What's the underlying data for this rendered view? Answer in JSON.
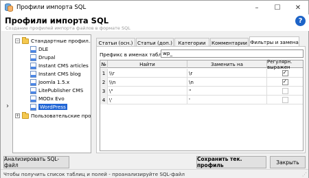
{
  "window": {
    "title": "Профили импорта SQL",
    "minimize": "–",
    "maximize": "☐",
    "close": "✕"
  },
  "header": {
    "title": "Профили импорта SQL",
    "subtitle": "Создание профилей импорта файлов в формате SQL",
    "help": "?"
  },
  "tree": {
    "items": [
      {
        "label": "Стандартные профил...",
        "type": "folder",
        "expander": "−"
      },
      {
        "label": "DLE",
        "type": "sql"
      },
      {
        "label": "Drupal",
        "type": "sql"
      },
      {
        "label": "Instant CMS articles",
        "type": "sql"
      },
      {
        "label": "Instant CMS blog",
        "type": "sql"
      },
      {
        "label": "Joomla 1.5.x",
        "type": "sql"
      },
      {
        "label": "LitePublisher CMS",
        "type": "sql"
      },
      {
        "label": "MODx Evo",
        "type": "sql"
      },
      {
        "label": "WordPress",
        "type": "sql",
        "selected": true
      },
      {
        "label": "Пользовательские про...",
        "type": "folder",
        "expander": "+"
      }
    ]
  },
  "tabs": [
    {
      "label": "Статьи (осн.)"
    },
    {
      "label": "Статьи (доп.)"
    },
    {
      "label": "Категории"
    },
    {
      "label": "Комментарии"
    },
    {
      "label": "Фильтры и замена",
      "active": true
    }
  ],
  "filters": {
    "prefix_label": "Префикс в именах таблиц:",
    "prefix_value": "wp_",
    "columns": [
      "№",
      "Найти",
      "Заменить на",
      "Регулярн. выражен"
    ],
    "rows": [
      {
        "num": "1",
        "find": "\\\\r",
        "replace": "\\r",
        "regex": true
      },
      {
        "num": "2",
        "find": "\\\\n",
        "replace": "\\n",
        "regex": true
      },
      {
        "num": "3",
        "find": "\\\"",
        "replace": "\"",
        "regex": false
      },
      {
        "num": "4",
        "find": "\\'",
        "replace": "'",
        "regex": false
      }
    ]
  },
  "buttons": {
    "analyze": "Анализировать SQL-файл",
    "save": "Сохранить тек. профиль",
    "close": "Закрыть"
  },
  "status": {
    "text": "Чтобы получить список таблиц и полей - проанализируйте SQL-файл"
  }
}
